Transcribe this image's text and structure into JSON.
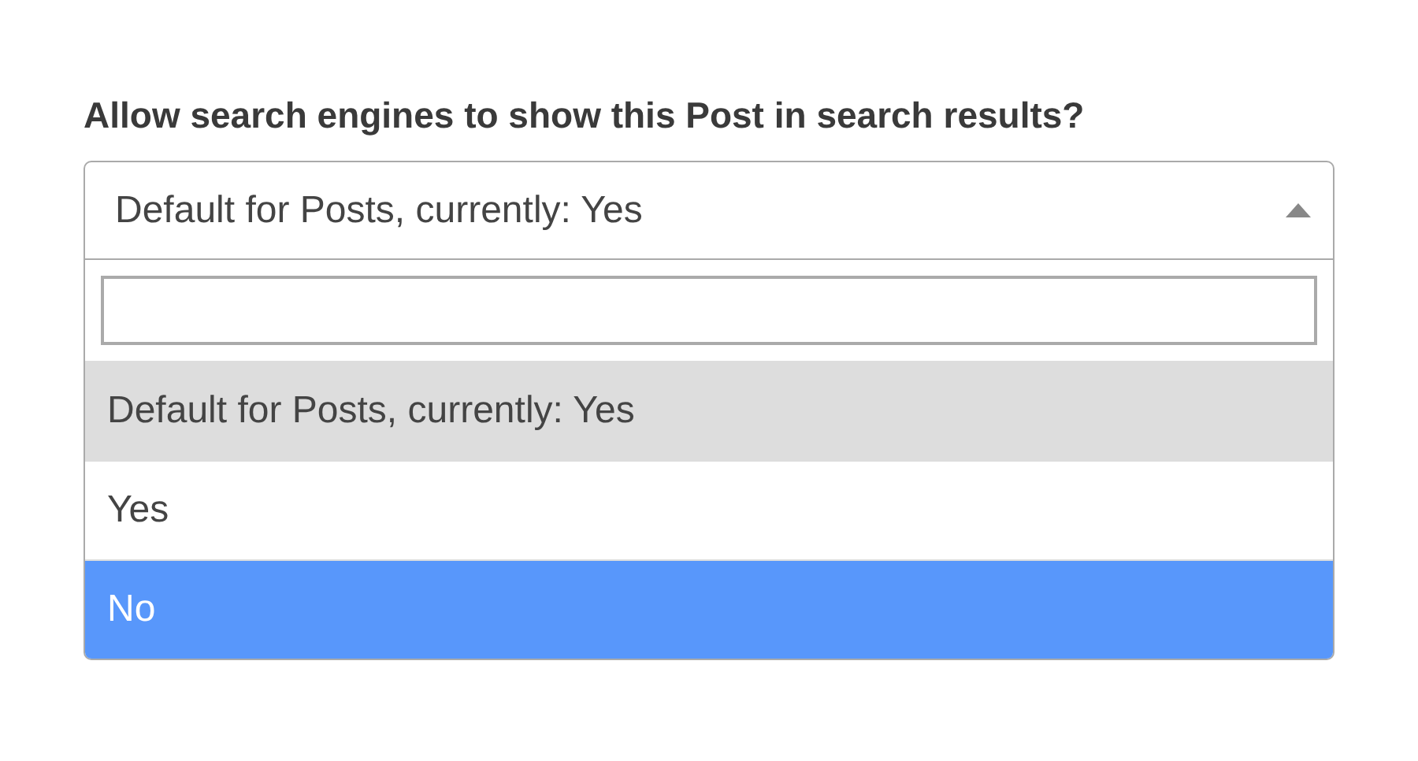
{
  "question": "Allow search engines to show this Post in search results?",
  "select": {
    "value": "Default for Posts, currently: Yes",
    "expanded": true
  },
  "options": [
    {
      "label": "Default for Posts, currently: Yes",
      "selected": true,
      "highlighted": false
    },
    {
      "label": "Yes",
      "selected": false,
      "highlighted": false
    },
    {
      "label": "No",
      "selected": false,
      "highlighted": true
    }
  ]
}
